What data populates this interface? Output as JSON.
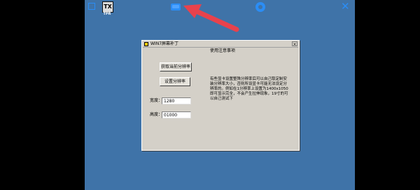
{
  "desktop": {
    "icon_glyph": "TX",
    "icon_label": "TPR"
  },
  "toolbar": {
    "icons": [
      "fullscreen-icon",
      "screen-icon",
      "settings-icon",
      "close-icon"
    ],
    "close_glyph": "✕"
  },
  "annotation": {
    "color": "#e8424c"
  },
  "window": {
    "title": "WIN7屏幕补丁",
    "close_glyph": "×",
    "get_resolution_button": "获取当前分辨率",
    "set_resolution_button": "设置分辨率",
    "width_label": "宽度：",
    "height_label": "高度：",
    "width_value": "1280",
    "height_value": "01000",
    "note_title": "使用注意事项",
    "note_body": "有些显卡设置整殊分辨率后可以自己取定制安装分辨率大小，否则所设显卡可能无法设定分辨率的。例如在1分辨率上设置为1400x1050即可显示完全，不会产生拉伸现象，19寸的可以自己测试下"
  },
  "colors": {
    "desktop": "#3f73a8",
    "toolbar_blue": "#2b8df5",
    "window_face": "#d4d0c8"
  }
}
